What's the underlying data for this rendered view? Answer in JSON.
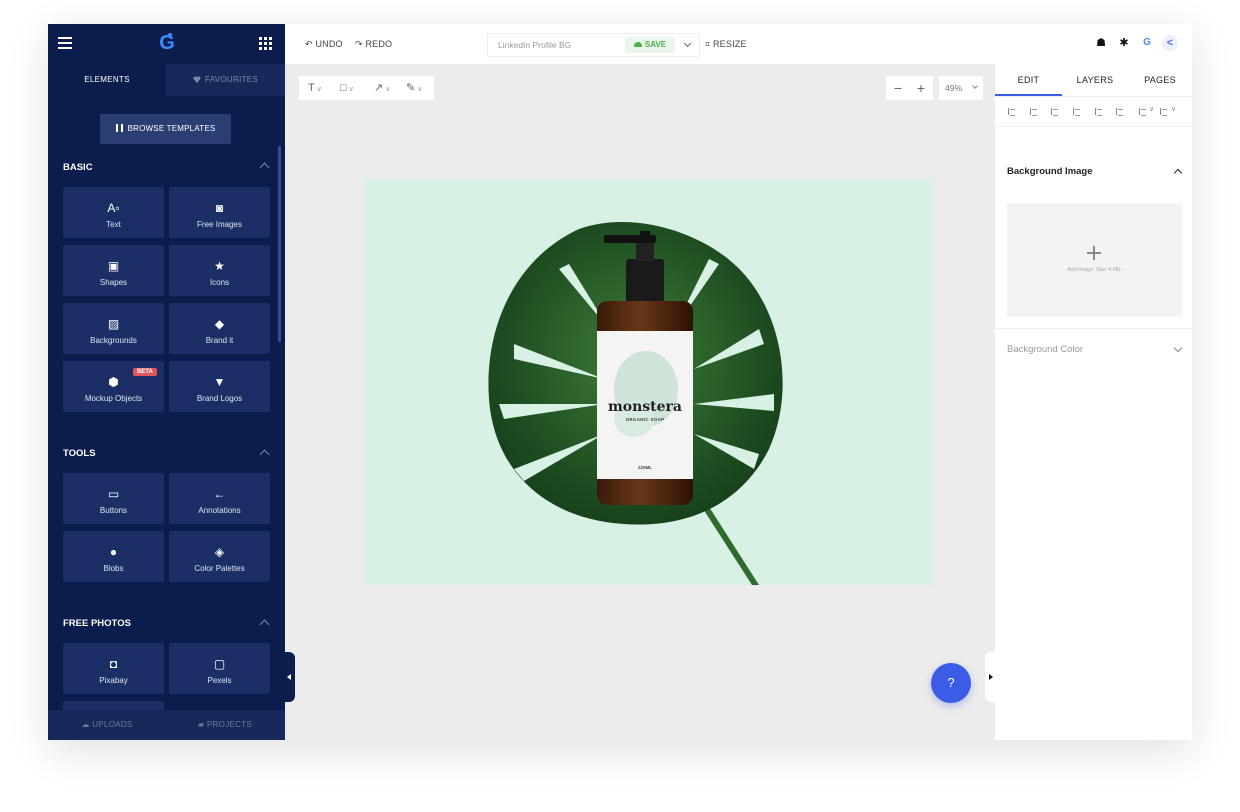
{
  "sidebar": {
    "tabs": {
      "elements": "ELEMENTS",
      "favourites": "FAVOURITES"
    },
    "browse_templates": "BROWSE TEMPLATES",
    "sections": {
      "basic": {
        "title": "BASIC",
        "items": [
          "Text",
          "Free Images",
          "Shapes",
          "Icons",
          "Backgrounds",
          "Brand it",
          "Mockup Objects",
          "Brand Logos"
        ],
        "beta_badge": "BETA"
      },
      "tools": {
        "title": "TOOLS",
        "items": [
          "Buttons",
          "Annotations",
          "Blobs",
          "Color Palettes"
        ]
      },
      "free_photos": {
        "title": "FREE PHOTOS",
        "items": [
          "Pixabay",
          "Pexels"
        ]
      }
    },
    "footer": {
      "uploads": "UPLOADS",
      "projects": "PROJECTS"
    }
  },
  "topbar": {
    "undo": "UNDO",
    "redo": "REDO",
    "document_title": "LinkedIn Profile BG",
    "save": "SAVE",
    "resize": "RESIZE"
  },
  "canvas": {
    "zoom": "49%",
    "help": "?",
    "artwork": {
      "brand": "monstera",
      "subtitle": "ORGANIC SOAP",
      "volume": "220ML",
      "background_color": "#d9f0e4"
    }
  },
  "right_panel": {
    "tabs": [
      "EDIT",
      "LAYERS",
      "PAGES"
    ],
    "background_image": "Background Image",
    "add_image_hint": "Add image. Max 4 Mb.",
    "background_color": "Background Color"
  },
  "colors": {
    "sidebar_bg": "#0c1d4d",
    "tile_bg": "#1b2f66",
    "accent": "#3a5ce6",
    "save_green": "#4caf50",
    "beta_red": "#e2555e"
  }
}
